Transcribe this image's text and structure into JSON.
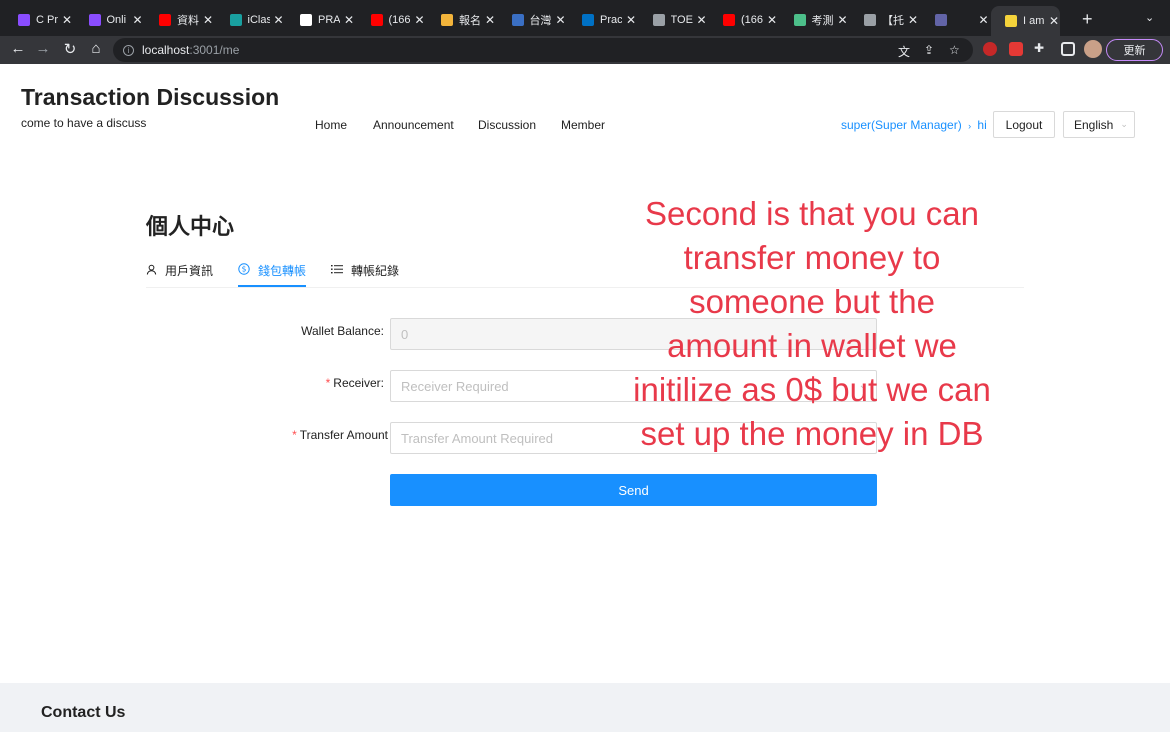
{
  "browser": {
    "tabs": [
      {
        "title": "C Pr",
        "favicon": "proton-icon",
        "color": "#8a4dff"
      },
      {
        "title": "Onli",
        "favicon": "proton-icon",
        "color": "#8a4dff"
      },
      {
        "title": "資料",
        "favicon": "youtube-icon",
        "color": "#ff0000"
      },
      {
        "title": "iClas",
        "favicon": "iclass-icon",
        "color": "#19a0a0"
      },
      {
        "title": "PRA",
        "favicon": "github-icon",
        "color": "#ffffff"
      },
      {
        "title": "(166",
        "favicon": "youtube-icon",
        "color": "#ff0000"
      },
      {
        "title": "報名",
        "favicon": "image-icon",
        "color": "#f3b43b"
      },
      {
        "title": "台灣",
        "favicon": "globe-icon",
        "color": "#3a6fc4"
      },
      {
        "title": "Prac",
        "favicon": "intel-icon",
        "color": "#0071c5"
      },
      {
        "title": "TOE",
        "favicon": "globe-icon",
        "color": "#9aa0a6"
      },
      {
        "title": "(166",
        "favicon": "youtube-icon",
        "color": "#ff0000"
      },
      {
        "title": "考測",
        "favicon": "leaf-icon",
        "color": "#4cbf8a"
      },
      {
        "title": "【托",
        "favicon": "globe-icon",
        "color": "#9aa0a6"
      },
      {
        "title": "",
        "favicon": "teams-icon",
        "color": "#6264a7"
      },
      {
        "title": "I am",
        "favicon": "fun-icon",
        "color": "#f5d33b"
      }
    ],
    "url_host": "localhost",
    "url_path": ":3001/me",
    "update_label": "更新"
  },
  "header": {
    "title": "Transaction Discussion",
    "subtitle": "come to have a discuss",
    "nav": [
      "Home",
      "Announcement",
      "Discussion",
      "Member"
    ],
    "user": "super(Super Manager)",
    "user_greeting": "hi",
    "logout": "Logout",
    "language": "English"
  },
  "profile": {
    "heading": "個人中心",
    "tabs": [
      "用戶資訊",
      "錢包轉帳",
      "轉帳紀錄"
    ],
    "active_tab": "錢包轉帳"
  },
  "form": {
    "balance_label": "Wallet Balance",
    "balance_value": "0",
    "receiver_label": "Receiver",
    "receiver_placeholder": "Receiver Required",
    "amount_label": "Transfer Amount",
    "amount_placeholder": "Transfer Amount Required",
    "colon": ":",
    "required_mark": "*",
    "send": "Send"
  },
  "overlay_text": "Second is that you can transfer money to someone but the amount in wallet we initilize as 0$ but we can set up the money in DB",
  "footer": {
    "title": "Contact Us"
  },
  "colors": {
    "primary": "#1890ff",
    "overlay": "#e8394a",
    "required": "#ff4d4f"
  }
}
